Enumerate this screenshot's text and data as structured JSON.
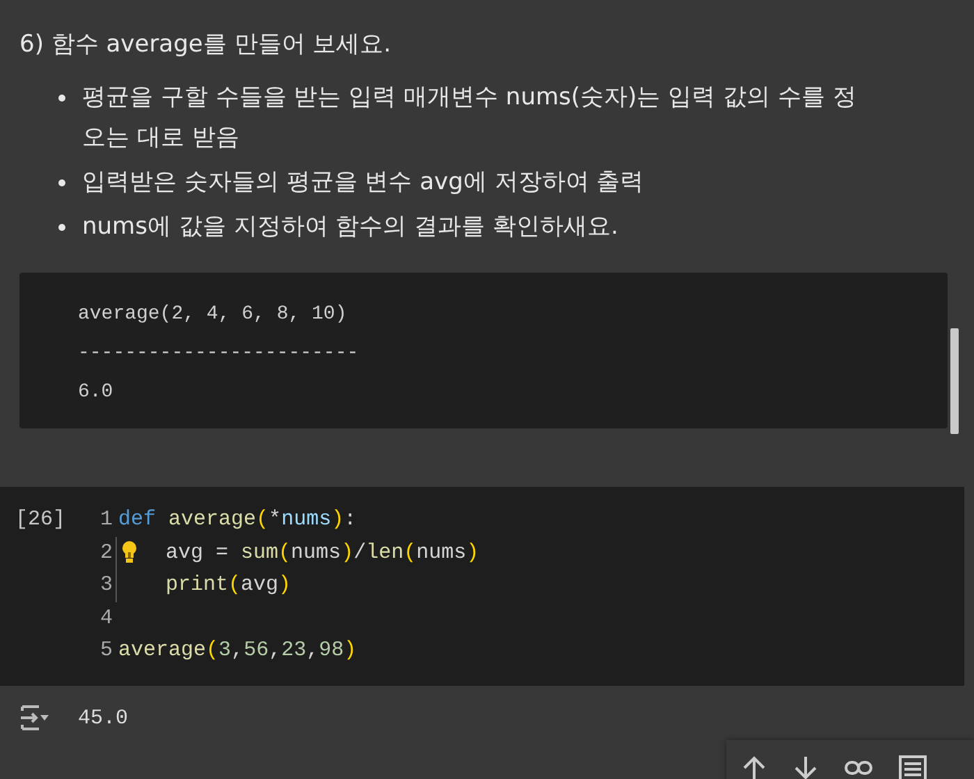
{
  "markdown": {
    "heading": "6) 함수 average를 만들어 보세요.",
    "bullets": [
      {
        "lines": [
          "평균을 구할 수들을 받는 입력 매개변수 nums(숫자)는 입력 값의 수를 정",
          "오는 대로 받음"
        ]
      },
      {
        "lines": [
          "입력받은 숫자들의 평균을 변수 avg에 저장하여 출력"
        ]
      },
      {
        "lines": [
          "nums에 값을 지정하여 함수의 결과를 확인하새요."
        ]
      }
    ],
    "code_block": [
      "average(2, 4, 6, 8, 10)",
      "------------------------",
      "6.0"
    ]
  },
  "code_cell": {
    "execution_count": "[26]",
    "lines": [
      {
        "number": "1",
        "hint": false,
        "indented": false,
        "tokens": [
          {
            "kind": "keyword",
            "text": "def"
          },
          {
            "kind": "function",
            "text": " average"
          },
          {
            "kind": "paren",
            "text": "("
          },
          {
            "kind": "plain",
            "text": "*"
          },
          {
            "kind": "param",
            "text": "nums"
          },
          {
            "kind": "paren",
            "text": ")"
          },
          {
            "kind": "plain",
            "text": ":"
          }
        ]
      },
      {
        "number": "2",
        "hint": true,
        "indented": true,
        "tokens": [
          {
            "kind": "plain",
            "text": "avg = "
          },
          {
            "kind": "function",
            "text": "sum"
          },
          {
            "kind": "paren",
            "text": "("
          },
          {
            "kind": "plain",
            "text": "nums"
          },
          {
            "kind": "paren",
            "text": ")"
          },
          {
            "kind": "plain",
            "text": "/"
          },
          {
            "kind": "function",
            "text": "len"
          },
          {
            "kind": "paren",
            "text": "("
          },
          {
            "kind": "plain",
            "text": "nums"
          },
          {
            "kind": "paren",
            "text": ")"
          }
        ]
      },
      {
        "number": "3",
        "hint": false,
        "indented": true,
        "tokens": [
          {
            "kind": "function",
            "text": "print"
          },
          {
            "kind": "paren",
            "text": "("
          },
          {
            "kind": "plain",
            "text": "avg"
          },
          {
            "kind": "paren",
            "text": ")"
          }
        ]
      },
      {
        "number": "4",
        "hint": false,
        "indented": false
      },
      {
        "number": "5",
        "hint": false,
        "indented": false,
        "tokens": [
          {
            "kind": "function",
            "text": "average"
          },
          {
            "kind": "paren",
            "text": "("
          },
          {
            "kind": "number",
            "text": "3"
          },
          {
            "kind": "plain",
            "text": ","
          },
          {
            "kind": "number",
            "text": "56"
          },
          {
            "kind": "plain",
            "text": ","
          },
          {
            "kind": "number",
            "text": "23"
          },
          {
            "kind": "plain",
            "text": ","
          },
          {
            "kind": "number",
            "text": "98"
          },
          {
            "kind": "paren",
            "text": ")"
          }
        ]
      }
    ],
    "output": "45.0"
  }
}
